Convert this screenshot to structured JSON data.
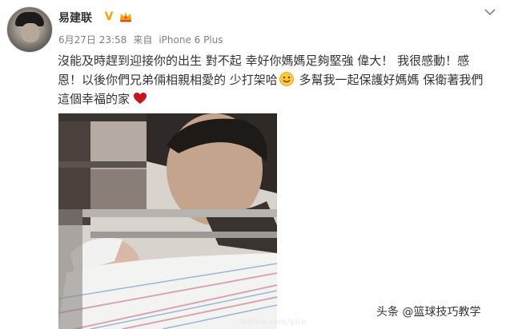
{
  "user": {
    "name": "易建联",
    "verified_badge": "V",
    "avatar_icon": "user-avatar-photo"
  },
  "post": {
    "date": "6月27日 23:58",
    "source_prefix": "来自",
    "device": "iPhone 6 Plus",
    "text_lines": [
      "沒能及時趕到迎接你的出生 對不起 幸好你媽媽足夠堅強 偉大！ 我很感動！感",
      "恩！以後你們兄弟倆相親相愛的 少打架哈",
      " 多幫我一起保護好媽媽 保衛著我們",
      "這個幸福的家"
    ],
    "inline_icons": [
      "smile-emoji-icon",
      "red-heart-icon"
    ]
  },
  "photo": {
    "watermark": "weibo.com/ylia"
  },
  "footer": {
    "source_watermark": "头条 @篮球技巧教学"
  },
  "colors": {
    "name_text": "#333333",
    "meta_text": "#808080",
    "badge_orange": "#f7a300",
    "heart_red": "#c4161c"
  }
}
